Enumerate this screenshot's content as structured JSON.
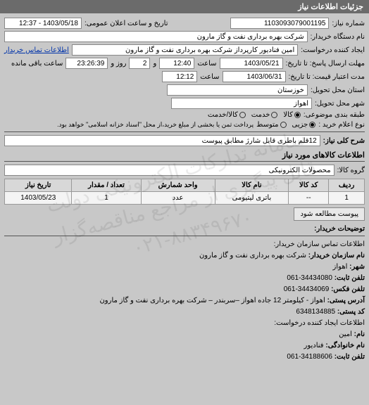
{
  "header": "جزئیات اطلاعات نیاز",
  "watermark_line1": "سامانه تدارکات الکترونیکی دولت",
  "watermark_line2": "قابل پیگیری از مراجع مناقصه‌گزار",
  "watermark_line3": "۰۲۱-۸۸۳۴۹۶۷۰",
  "need_number_label": "شماره نیاز:",
  "need_number": "1103093079001195",
  "announce_label": "تاریخ و ساعت اعلان عمومی:",
  "announce": "1403/05/18 - 12:37",
  "buyer_device_label": "نام دستگاه خریدار:",
  "buyer_device": "شرکت بهره برداری نفت و گاز مارون",
  "creator_label": "ایجاد کننده درخواست:",
  "creator": "امین فنادیور کارپرداز شرکت بهره برداری نفت و گاز مارون",
  "contact_link": "اطلاعات تماس خریدار",
  "deadline_label": "مهلت ارسال پاسخ: تا تاریخ:",
  "deadline_date": "1403/05/21",
  "time_label": "ساعت",
  "deadline_time": "12:40",
  "and_label": "و",
  "days": "2",
  "days_label": "روز و",
  "remaining": "23:26:39",
  "remaining_label": "ساعت باقی مانده",
  "validity_label": "مدت اعتبار قیمت: تا تاریخ:",
  "validity_date": "1403/06/31",
  "validity_time": "12:12",
  "province_label": "استان محل تحویل:",
  "province": "خوزستان",
  "city_label": "شهر محل تحویل:",
  "city": "اهواز",
  "category_label": "طبقه بندی موضوعی:",
  "radios_cat": [
    {
      "label": "کالا",
      "selected": true
    },
    {
      "label": "خدمت",
      "selected": false
    },
    {
      "label": "کالا/خدمت",
      "selected": false
    }
  ],
  "purchase_type_label": "نوع اعلام خرید :",
  "radios_type": [
    {
      "label": "جزیی",
      "selected": true
    },
    {
      "label": "متوسط",
      "selected": false
    }
  ],
  "purchase_note": "پرداخت ثمن یا بخشی از مبلغ خرید،از محل \"اسناد خزانه اسلامی\" خواهد بود.",
  "main_title_label": "شرح کلی نیاز:",
  "main_title": "12قلم باطری قابل شارژ مطابق پیوست",
  "goods_section": "اطلاعات کالاهای مورد نیاز",
  "goods_group_label": "گروه کالا:",
  "goods_group": "محصولات الکترونیکی",
  "table": {
    "headers": [
      "ردیف",
      "کد کالا",
      "نام کالا",
      "واحد شمارش",
      "تعداد / مقدار",
      "تاریخ نیاز"
    ],
    "row": [
      "1",
      "--",
      "باتری لیتیومی",
      "عدد",
      "1",
      "1403/05/23"
    ]
  },
  "attach_btn": "پیوست مطالعه شود",
  "descriptions_label": "توضیحات خریدار:",
  "contact_section": "اطلاعات تماس سازمان خریدار:",
  "org_name_label": "نام سازمان خریدار:",
  "org_name": "شرکت بهره برداری نفت و گاز مارون",
  "org_city_label": "شهر:",
  "org_city": "اهواز",
  "org_phone_label": "تلفن ثابت:",
  "org_phone": "34434080-061",
  "org_fax_label": "تلفن فکس:",
  "org_fax": "34434069-061",
  "org_addr_label": "آدرس پستی:",
  "org_addr": "اهواز - کیلومتر 12 جاده اهواز –سربندر – شرکت بهره برداری نفت و گاز مارون",
  "org_post_label": "کد پستی:",
  "org_post": "6348134885",
  "creator_section": "اطلاعات ایجاد کننده درخواست:",
  "cr_name_label": "نام:",
  "cr_name": "امین",
  "cr_family_label": "نام خانوادگی:",
  "cr_family": "فنادیور",
  "cr_phone_label": "تلفن ثابت:",
  "cr_phone": "34188606-061"
}
